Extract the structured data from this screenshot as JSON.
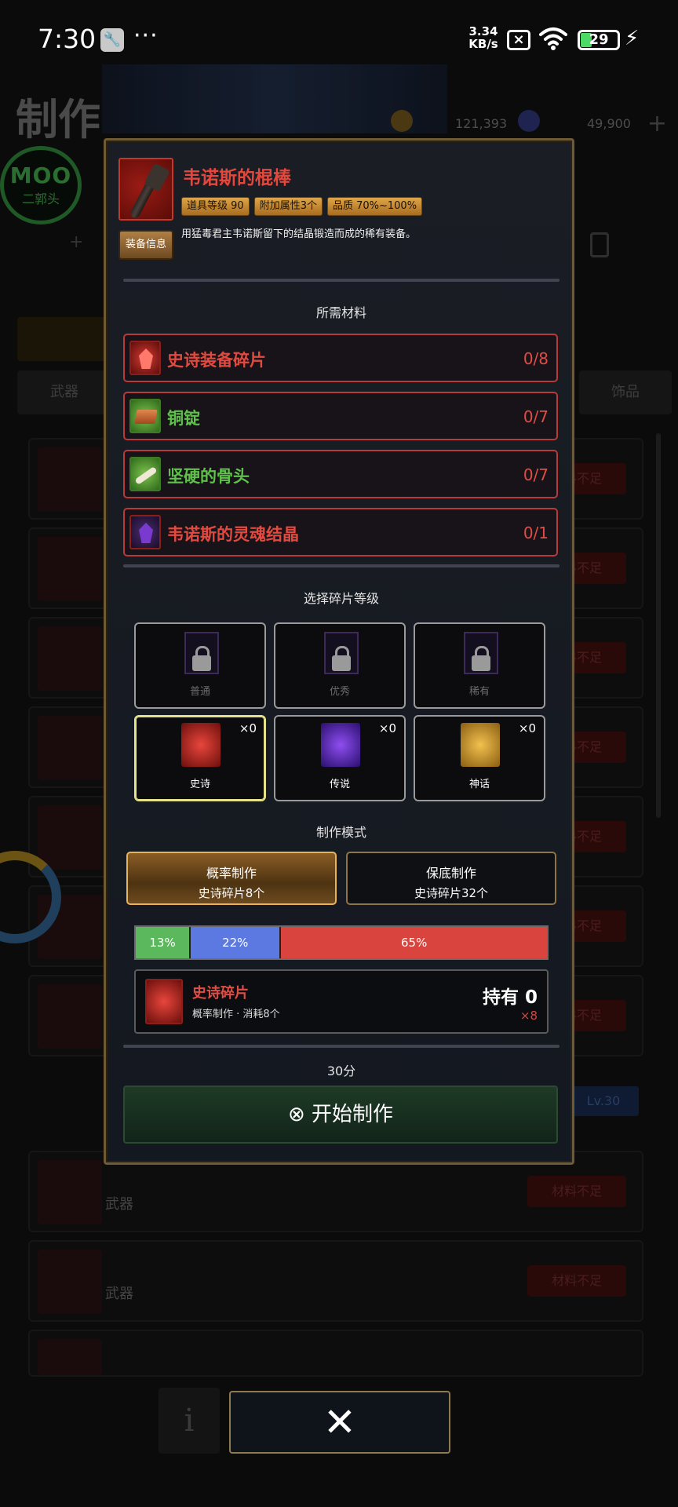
{
  "status_bar": {
    "time": "7:30",
    "dots": "···",
    "speed_value": "3.34",
    "speed_unit": "KB/s",
    "battery": "29"
  },
  "background": {
    "title": "制作",
    "currency1": "121,393",
    "currency2": "49,900",
    "moo_logo": "MOO",
    "moo_sub": "二郭头",
    "tab_weapons": "武器",
    "tab_accessories": "饰品",
    "insufficient": "材料不足",
    "category": "武器",
    "level_badge": "Lv.30"
  },
  "modal": {
    "item_name": "韦诺斯的棍棒",
    "badges": [
      "道具等级 90",
      "附加属性3个",
      "品质 70%~100%"
    ],
    "description": "用猛毒君主韦诺斯留下的结晶锻造而成的稀有装备。",
    "equip_info_btn": "装备信息",
    "materials_title": "所需材料",
    "materials": [
      {
        "name": "史诗装备碎片",
        "count": "0/8",
        "color": "#e24a40"
      },
      {
        "name": "铜锭",
        "count": "0/7",
        "color": "#5ec24a"
      },
      {
        "name": "坚硬的骨头",
        "count": "0/7",
        "color": "#5ec24a"
      },
      {
        "name": "韦诺斯的灵魂结晶",
        "count": "0/1",
        "color": "#e24a40"
      }
    ],
    "grade_title": "选择碎片等级",
    "grades_locked": [
      "普通",
      "优秀",
      "稀有"
    ],
    "grades_unlocked": [
      {
        "label": "史诗",
        "qty": "×0"
      },
      {
        "label": "传说",
        "qty": "×0"
      },
      {
        "label": "神话",
        "qty": "×0"
      }
    ],
    "mode_title": "制作模式",
    "mode_probability": {
      "title": "概率制作",
      "cost": "史诗碎片8个"
    },
    "mode_guaranteed": {
      "title": "保底制作",
      "cost": "史诗碎片32个"
    },
    "probabilities": [
      {
        "label": "13%",
        "value": 13
      },
      {
        "label": "22%",
        "value": 22
      },
      {
        "label": "65%",
        "value": 65
      }
    ],
    "consume": {
      "name": "史诗碎片",
      "desc": "概率制作 · 消耗8个",
      "have": "持有 0",
      "need": "×8"
    },
    "time": "30分",
    "start_button": "⊗ 开始制作"
  },
  "close_button": "✕",
  "info_button": "i"
}
